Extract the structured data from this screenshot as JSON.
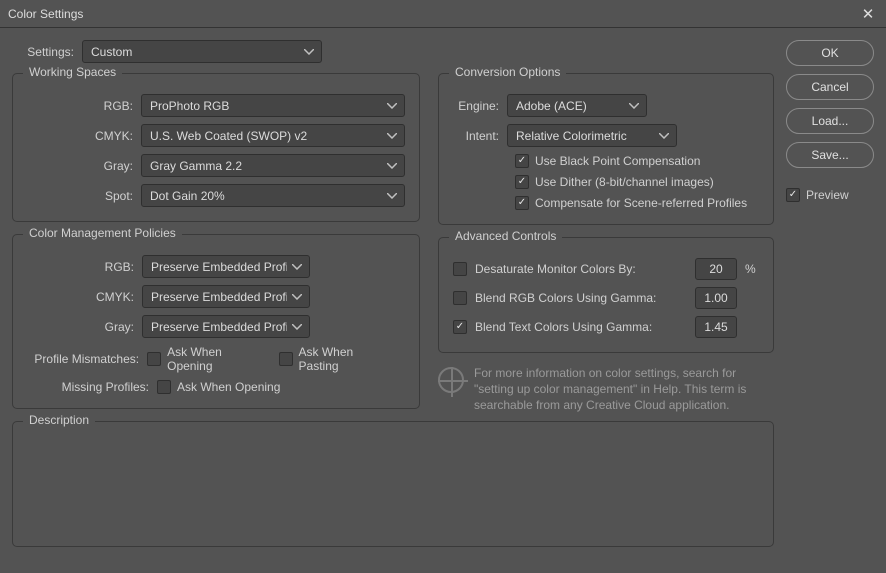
{
  "title": "Color Settings",
  "settings": {
    "label": "Settings:",
    "value": "Custom"
  },
  "workingSpaces": {
    "legend": "Working Spaces",
    "rgbLabel": "RGB:",
    "rgb": "ProPhoto RGB",
    "cmykLabel": "CMYK:",
    "cmyk": "U.S. Web Coated (SWOP) v2",
    "grayLabel": "Gray:",
    "gray": "Gray Gamma 2.2",
    "spotLabel": "Spot:",
    "spot": "Dot Gain 20%"
  },
  "policies": {
    "legend": "Color Management Policies",
    "rgbLabel": "RGB:",
    "rgb": "Preserve Embedded Profiles",
    "cmykLabel": "CMYK:",
    "cmyk": "Preserve Embedded Profiles",
    "grayLabel": "Gray:",
    "gray": "Preserve Embedded Profiles",
    "mismatchLabel": "Profile Mismatches:",
    "askOpenLabel": "Ask When Opening",
    "askPasteLabel": "Ask When Pasting",
    "missingLabel": "Missing Profiles:"
  },
  "conversion": {
    "legend": "Conversion Options",
    "engineLabel": "Engine:",
    "engine": "Adobe (ACE)",
    "intentLabel": "Intent:",
    "intent": "Relative Colorimetric",
    "bpc": "Use Black Point Compensation",
    "dither": "Use Dither (8-bit/channel images)",
    "scene": "Compensate for Scene-referred Profiles"
  },
  "advanced": {
    "legend": "Advanced Controls",
    "desat": "Desaturate Monitor Colors By:",
    "desatVal": "20",
    "pct": "%",
    "blendRgb": "Blend RGB Colors Using Gamma:",
    "blendRgbVal": "1.00",
    "blendText": "Blend Text Colors Using Gamma:",
    "blendTextVal": "1.45"
  },
  "info": "For more information on color settings, search for \"setting up color management\" in Help. This term is searchable from any Creative Cloud application.",
  "description": {
    "legend": "Description"
  },
  "buttons": {
    "ok": "OK",
    "cancel": "Cancel",
    "load": "Load...",
    "save": "Save..."
  },
  "preview": "Preview"
}
